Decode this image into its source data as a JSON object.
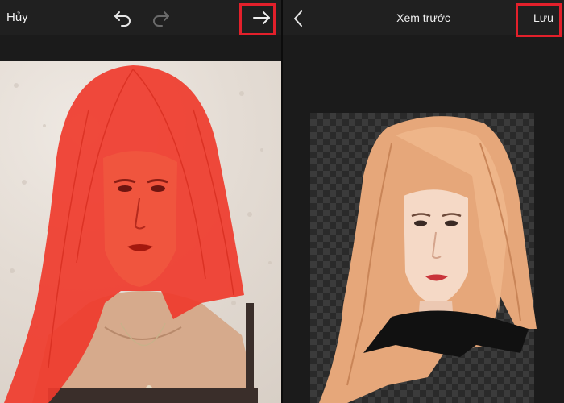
{
  "left_screen": {
    "cancel_label": "Hủy",
    "icons": [
      "undo-icon",
      "redo-icon",
      "arrow-right-icon"
    ]
  },
  "right_screen": {
    "title": "Xem trước",
    "save_label": "Lưu",
    "icons": [
      "chevron-left-icon"
    ]
  },
  "colors": {
    "highlight_box": "#e3202b",
    "mask_red": "#ef3b2c",
    "toolbar_bg": "#202020",
    "panel_bg": "#1b1b1b"
  }
}
